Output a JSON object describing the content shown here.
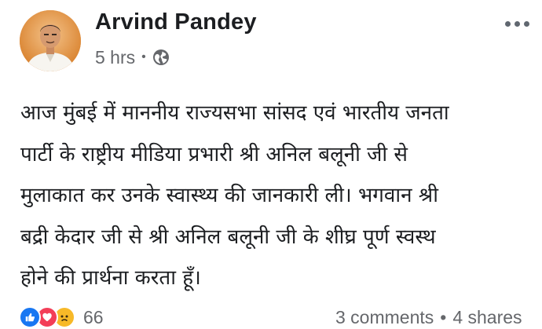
{
  "post": {
    "author": "Arvind Pandey",
    "timestamp": "5 hrs",
    "separator": "•",
    "privacy_icon": "globe-icon",
    "more_icon": "more-horizontal-icon",
    "text_lines": [
      "आज मुंबई में माननीय राज्यसभा सांसद एवं भारतीय जनता",
      "पार्टी के राष्ट्रीय मीडिया प्रभारी श्री अनिल बलूनी जी से",
      "मुलाकात कर उनके स्वास्थ्य की जानकारी ली। भगवान श्री",
      "बद्री केदार जी से श्री अनिल बलूनी जी के शीघ्र पूर्ण स्वस्थ",
      "होने की प्रार्थना करता हूँ।"
    ]
  },
  "footer": {
    "reactions": [
      "like-icon",
      "love-icon",
      "sad-icon"
    ],
    "reaction_count": "66",
    "comments": "3 comments",
    "separator": "•",
    "shares": "4 shares"
  },
  "colors": {
    "text": "#1c1e21",
    "secondary": "#65676b",
    "like": "#1877f2",
    "love": "#f33e58",
    "sad": "#f7b928"
  }
}
